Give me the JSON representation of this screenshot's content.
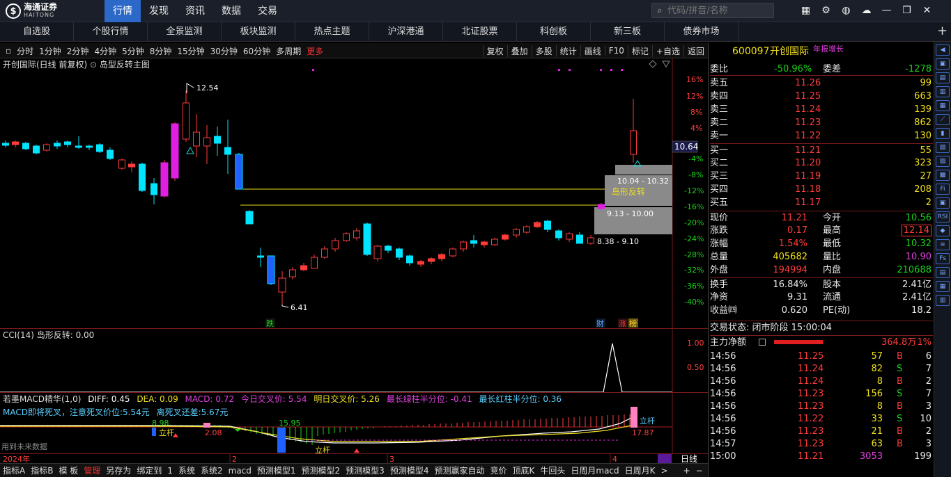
{
  "app": {
    "logo_cn": "海通证券",
    "logo_en": "HAITONG",
    "logo_mark": "$"
  },
  "topnav": [
    "行情",
    "发现",
    "资讯",
    "数据",
    "交易"
  ],
  "search": {
    "placeholder": "代码/拼音/名称"
  },
  "nav2": [
    "自选股",
    "个股行情",
    "全景监测",
    "板块监测",
    "热点主题",
    "沪深港通",
    "北证股票",
    "科创板",
    "新三板",
    "债券市场"
  ],
  "periods": [
    "分时",
    "1分钟",
    "2分钟",
    "4分钟",
    "5分钟",
    "8分钟",
    "15分钟",
    "30分钟",
    "60分钟",
    "多周期",
    "更多"
  ],
  "chart_tools": [
    "复权",
    "叠加",
    "多股",
    "统计",
    "画线",
    "F10",
    "标记",
    "+自选",
    "返回"
  ],
  "chart_title": "开创国际(日线 前复权)",
  "indicator_main": "岛型反转主图",
  "current_price_tag": "10.64",
  "price_annotations": {
    "high": "12.54",
    "low": "6.41",
    "box1": "10.04 - 10.32",
    "box1_label": "岛形反转",
    "box2": "9.13 - 10.00",
    "box3": "8.38 - 9.10",
    "mark_die": "跌",
    "mark_cai": "财",
    "mark_zhang": "涨",
    "mark_bang": "榜"
  },
  "y_axis_pct": [
    "16%",
    "12%",
    "8%",
    "4%",
    "-4%",
    "-8%",
    "-12%",
    "-16%",
    "-20%",
    "-24%",
    "-28%",
    "-32%",
    "-36%",
    "-40%"
  ],
  "cci": {
    "title": "CCI(14) 岛形反转: 0.00",
    "ticks": [
      "1.00",
      "0.50"
    ]
  },
  "macd": {
    "name": "若墨MACD精华(1,0)",
    "diff": "DIFF: 0.45",
    "dea": "DEA: 0.09",
    "macd": "MACD: 0.72",
    "today_cross": "今日交叉价: 5.54",
    "tomorrow_cross": "明日交叉价: 5.26",
    "green_half": "最长绿柱半分位: -0.41",
    "red_half": "最长红柱半分位: 0.36",
    "line2_a": "MACD即将死叉，注意死叉价位:5.54元",
    "line2_b": "离死叉还差:5.67元",
    "label_898": "8.98",
    "label_1595": "15.95",
    "label_208": "2.08",
    "label_1787": "17.87",
    "lg1": "立杆",
    "lg2": "立杆",
    "lg3": "立杆",
    "future": "用到未来数据"
  },
  "date_axis": {
    "year": "2024年",
    "m2": "2",
    "m3": "3",
    "m4": "4",
    "daily": "日线"
  },
  "bottom_tabs": [
    "指标A",
    "指标B",
    "模 板",
    "管理",
    "另存为",
    "绑定到",
    "1",
    "系统",
    "系统2",
    "macd",
    "预测模型1",
    "预测模型2",
    "预测模型3",
    "预测模型4",
    "预测赢家自动",
    "竞价",
    "顶底K",
    "牛回头",
    "日周月macd",
    "日周月K",
    ">"
  ],
  "quote": {
    "code": "600097",
    "name": "开创国际",
    "tag": "年报增长",
    "webi_label": "委比",
    "webi": "-50.96%",
    "weicha_label": "委差",
    "weicha": "-1278",
    "asks": [
      {
        "l": "卖五",
        "p": "11.26",
        "v": "99"
      },
      {
        "l": "卖四",
        "p": "11.25",
        "v": "663"
      },
      {
        "l": "卖三",
        "p": "11.24",
        "v": "139"
      },
      {
        "l": "卖二",
        "p": "11.23",
        "v": "862"
      },
      {
        "l": "卖一",
        "p": "11.22",
        "v": "130"
      }
    ],
    "bids": [
      {
        "l": "买一",
        "p": "11.21",
        "v": "55"
      },
      {
        "l": "买二",
        "p": "11.20",
        "v": "323"
      },
      {
        "l": "买三",
        "p": "11.19",
        "v": "27"
      },
      {
        "l": "买四",
        "p": "11.18",
        "v": "208"
      },
      {
        "l": "买五",
        "p": "11.17",
        "v": "2"
      }
    ],
    "stats": [
      {
        "l1": "现价",
        "v1": "11.21",
        "c1": "red",
        "l2": "今开",
        "v2": "10.56",
        "c2": "grn"
      },
      {
        "l1": "涨跌",
        "v1": "0.17",
        "c1": "red",
        "l2": "最高",
        "v2": "12.14",
        "c2": "red"
      },
      {
        "l1": "涨幅",
        "v1": "1.54%",
        "c1": "red",
        "l2": "最低",
        "v2": "10.32",
        "c2": "grn"
      },
      {
        "l1": "总量",
        "v1": "405682",
        "c1": "yel",
        "l2": "量比",
        "v2": "10.90",
        "c2": "mag"
      },
      {
        "l1": "外盘",
        "v1": "194994",
        "c1": "red",
        "l2": "内盘",
        "v2": "210688",
        "c2": "grn"
      }
    ],
    "stats2": [
      {
        "l1": "换手",
        "v1": "16.84%",
        "l2": "股本",
        "v2": "2.41亿"
      },
      {
        "l1": "净资",
        "v1": "9.31",
        "l2": "流通",
        "v2": "2.41亿"
      },
      {
        "l1": "收益㈣",
        "v1": "0.620",
        "l2": "PE(动)",
        "v2": "18.2"
      }
    ],
    "trade_status": "交易状态: 闭市阶段 15:00:04",
    "main_net_label": "主力净额",
    "main_net": "364.8万",
    "main_net_pct": "1%",
    "ticks": [
      {
        "t": "14:56",
        "p": "11.25",
        "v": "57",
        "bs": "B",
        "n": "6"
      },
      {
        "t": "14:56",
        "p": "11.24",
        "v": "82",
        "bs": "S",
        "n": "7"
      },
      {
        "t": "14:56",
        "p": "11.24",
        "v": "8",
        "bs": "B",
        "n": "2"
      },
      {
        "t": "14:56",
        "p": "11.23",
        "v": "156",
        "bs": "S",
        "n": "7"
      },
      {
        "t": "14:56",
        "p": "11.23",
        "v": "8",
        "bs": "B",
        "n": "3"
      },
      {
        "t": "14:56",
        "p": "11.22",
        "v": "33",
        "bs": "S",
        "n": "10"
      },
      {
        "t": "14:56",
        "p": "11.23",
        "v": "21",
        "bs": "B",
        "n": "2"
      },
      {
        "t": "14:57",
        "p": "11.23",
        "v": "63",
        "bs": "B",
        "n": "3"
      },
      {
        "t": "15:00",
        "p": "11.21",
        "v": "3053",
        "bs": "",
        "n": "199"
      }
    ]
  },
  "side_icons": [
    "◀",
    "▣",
    "▤",
    "▥",
    "▦",
    "⟋",
    "▮",
    "▧",
    "▨",
    "▩",
    "Fi",
    "▣",
    "RSI",
    "◆",
    "≡",
    "Fs",
    "▤",
    "▦",
    "▥"
  ],
  "colors": {
    "up": "#ff3b3b",
    "down": "#00e5ff",
    "accent": "#2b68c8",
    "magenta": "#e020e0"
  }
}
